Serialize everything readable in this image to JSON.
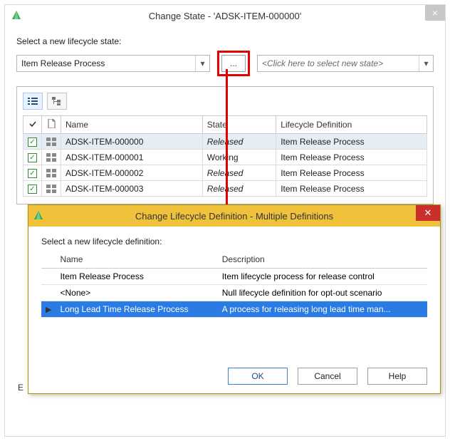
{
  "main_dialog": {
    "title": "Change State - 'ADSK-ITEM-000000'",
    "select_label": "Select a new lifecycle state:",
    "lifecycle_value": "Item Release Process",
    "browse_label": "...",
    "state_placeholder": "<Click here to select new state>",
    "columns": {
      "name": "Name",
      "state": "State",
      "lcdef": "Lifecycle Definition"
    },
    "partial_label": "E",
    "icons": {
      "check": "check-icon",
      "doc": "doc-icon",
      "list_view": "list-view-icon",
      "tree_view": "tree-view-icon",
      "chevron": "chevron-down-icon",
      "close": "close-icon",
      "app": "app-icon",
      "row_tile": "tile-icon"
    }
  },
  "items": [
    {
      "checked": true,
      "name": "ADSK-ITEM-000000",
      "state": "Released",
      "state_italic": true,
      "lcdef": "Item Release Process",
      "highlight": true
    },
    {
      "checked": true,
      "name": "ADSK-ITEM-000001",
      "state": "Working",
      "state_italic": false,
      "lcdef": "Item Release Process",
      "highlight": false
    },
    {
      "checked": true,
      "name": "ADSK-ITEM-000002",
      "state": "Released",
      "state_italic": true,
      "lcdef": "Item Release Process",
      "highlight": false
    },
    {
      "checked": true,
      "name": "ADSK-ITEM-000003",
      "state": "Released",
      "state_italic": true,
      "lcdef": "Item Release Process",
      "highlight": false
    }
  ],
  "inner_dialog": {
    "title": "Change Lifecycle Definition - Multiple Definitions",
    "select_label": "Select a new lifecycle definition:",
    "columns": {
      "name": "Name",
      "desc": "Description"
    },
    "buttons": {
      "ok": "OK",
      "cancel": "Cancel",
      "help": "Help"
    }
  },
  "definitions": [
    {
      "name": "Item Release Process",
      "desc": "Item lifecycle process for release control",
      "selected": false
    },
    {
      "name": "<None>",
      "desc": "Null lifecycle definition for opt-out scenario",
      "selected": false
    },
    {
      "name": "Long Lead Time Release Process",
      "desc": "A process for releasing long lead time man...",
      "selected": true
    }
  ],
  "annotation": {
    "type": "callout-arrow",
    "color": "#e30000"
  }
}
